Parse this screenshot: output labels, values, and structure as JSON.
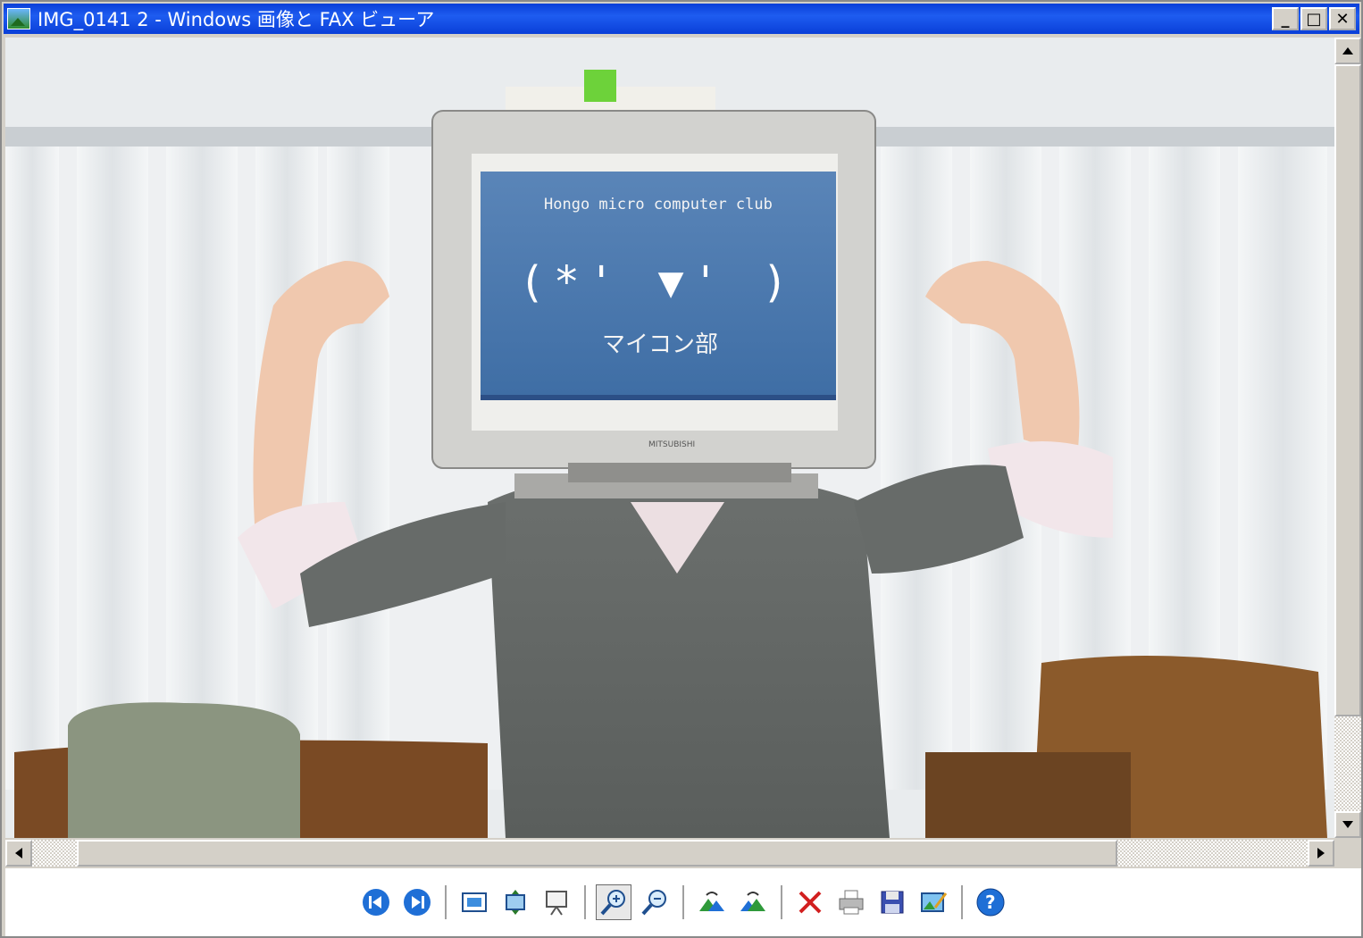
{
  "window": {
    "title": "IMG_0141 2 - Windows 画像と FAX ビューア",
    "buttons": {
      "minimize": "_",
      "maximize": "□",
      "close": "✕"
    }
  },
  "photo": {
    "screen_text": "Hongo micro computer club",
    "emoticon": "(*' ▼' )",
    "screen_label": "マイコン部",
    "monitor_brand": "MITSUBISHI"
  },
  "scrollbars": {
    "vertical_position": 0.0,
    "horizontal_position": 0.05
  },
  "toolbar": {
    "items": [
      {
        "name": "previous-image-button",
        "icon": "previous-icon"
      },
      {
        "name": "next-image-button",
        "icon": "next-icon"
      },
      {
        "name": "best-fit-button",
        "icon": "best-fit-icon"
      },
      {
        "name": "actual-size-button",
        "icon": "actual-size-icon"
      },
      {
        "name": "slideshow-button",
        "icon": "slideshow-icon"
      },
      {
        "name": "zoom-in-button",
        "icon": "zoom-in-icon",
        "active": true
      },
      {
        "name": "zoom-out-button",
        "icon": "zoom-out-icon"
      },
      {
        "name": "rotate-clockwise-button",
        "icon": "rotate-clockwise-icon"
      },
      {
        "name": "rotate-counterclockwise-button",
        "icon": "rotate-counterclockwise-icon"
      },
      {
        "name": "delete-button",
        "icon": "delete-icon"
      },
      {
        "name": "print-button",
        "icon": "print-icon"
      },
      {
        "name": "save-button",
        "icon": "save-icon"
      },
      {
        "name": "edit-button",
        "icon": "edit-icon"
      },
      {
        "name": "help-button",
        "icon": "help-icon"
      }
    ]
  }
}
